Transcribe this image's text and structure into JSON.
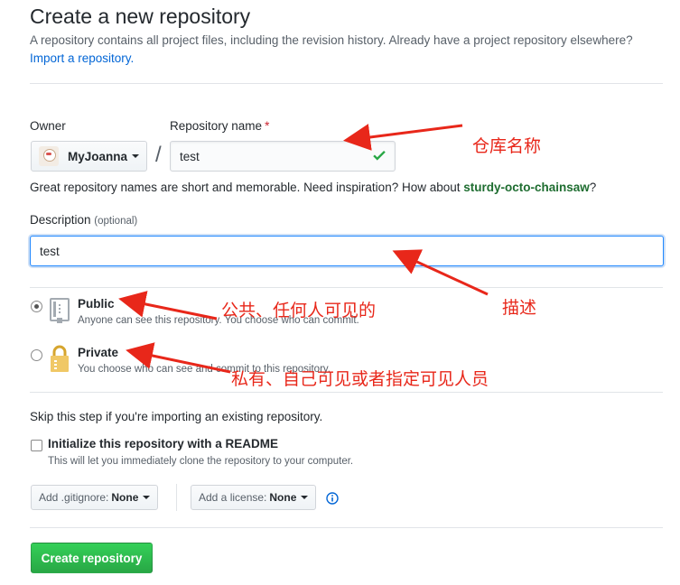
{
  "header": {
    "title": "Create a new repository",
    "description": "A repository contains all project files, including the revision history. Already have a project repository elsewhere?",
    "import_link": "Import a repository."
  },
  "owner": {
    "label": "Owner",
    "value": "MyJoanna"
  },
  "repo_name": {
    "label": "Repository name",
    "required_mark": "*",
    "value": "test",
    "separator": "/"
  },
  "hint": {
    "text": "Great repository names are short and memorable. Need inspiration? How about ",
    "suggestion": "sturdy-octo-chainsaw",
    "end": "?"
  },
  "description": {
    "label": "Description",
    "optional": "(optional)",
    "value": "test"
  },
  "visibility": {
    "public": {
      "title": "Public",
      "desc": "Anyone can see this repository. You choose who can commit.",
      "selected": true
    },
    "private": {
      "title": "Private",
      "desc": "You choose who can see and commit to this repository.",
      "selected": false
    }
  },
  "init": {
    "skip_text": "Skip this step if you're importing an existing repository.",
    "readme_label": "Initialize this repository with a README",
    "readme_desc": "This will let you immediately clone the repository to your computer.",
    "readme_checked": false
  },
  "gitignore": {
    "label": "Add .gitignore:",
    "value": "None"
  },
  "license": {
    "label": "Add a license:",
    "value": "None"
  },
  "submit_label": "Create repository",
  "annotations": {
    "repo_name": "仓库名称",
    "description": "描述",
    "public": "公共、任何人可见的",
    "private": "私有、自己可见或者指定可见人员"
  },
  "colors": {
    "accent_link": "#0366d6",
    "create_button": "#28a745",
    "annotation": "#e8271a",
    "checkmark": "#28a745"
  },
  "icons": [
    "caret-down-icon",
    "check-icon",
    "repo-icon",
    "lock-icon",
    "info-icon"
  ]
}
